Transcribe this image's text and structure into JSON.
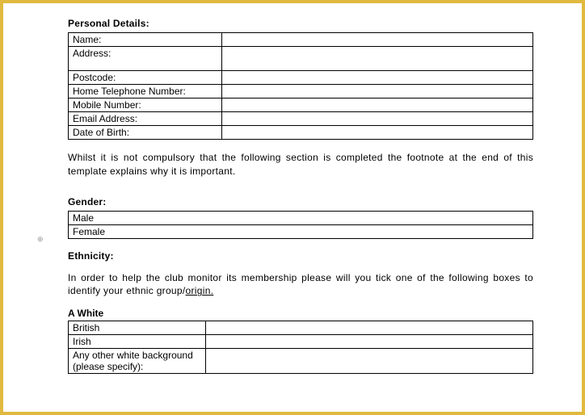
{
  "headings": {
    "personal": "Personal Details:",
    "gender": "Gender:",
    "ethnicity": "Ethnicity:",
    "a_white": "A White"
  },
  "personal_rows": {
    "name": "Name:",
    "address": "Address:",
    "postcode": "Postcode:",
    "home_tel": "Home Telephone Number:",
    "mobile": "Mobile Number:",
    "email": "Email Address:",
    "dob": "Date of Birth:"
  },
  "gender_rows": {
    "male": "Male",
    "female": "Female"
  },
  "ethnicity_rows": {
    "british": "British",
    "irish": "Irish",
    "other_white": "Any other white background (please specify):"
  },
  "paragraphs": {
    "compulsory_note": "Whilst it is not compulsory that the following section is completed the footnote at the end of this template explains why it is important.",
    "ethnicity_intro_a": "In order to help the club monitor its membership please will you tick one of the following boxes to identify your ethnic group/",
    "ethnicity_intro_b": "origin."
  },
  "marks": {
    "anchor": "⊕"
  }
}
